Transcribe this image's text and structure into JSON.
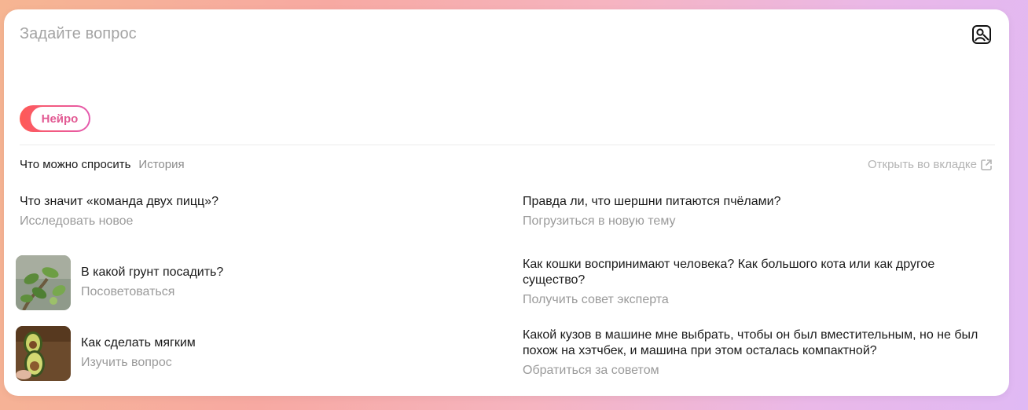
{
  "search": {
    "placeholder": "Задайте вопрос"
  },
  "toggle": {
    "label": "Нейро"
  },
  "tabs": [
    {
      "label": "Что можно спросить",
      "active": true
    },
    {
      "label": "История",
      "active": false
    }
  ],
  "open_in_tab": {
    "label": "Открыть во вкладке",
    "icon": "external-link-icon"
  },
  "suggestions_left": [
    {
      "question": "Что значит «команда двух пицц»?",
      "subtitle": "Исследовать новое",
      "thumbnail": null
    },
    {
      "question": "В какой грунт посадить?",
      "subtitle": "Посоветоваться",
      "thumbnail": "plant"
    },
    {
      "question": "Как сделать мягким",
      "subtitle": "Изучить вопрос",
      "thumbnail": "avocado"
    }
  ],
  "suggestions_right": [
    {
      "question": "Правда ли, что шершни питаются пчёлами?",
      "subtitle": "Погрузиться в новую тему"
    },
    {
      "question_line1": "Как кошки воспринимают человека? Как большого кота или как другое",
      "question_line2": "существо?",
      "subtitle": "Получить совет эксперта"
    },
    {
      "question_line1": "Какой кузов в машине мне выбрать, чтобы он был вместительным, но не был",
      "question_line2": "похож на хэтчбек, и машина при этом осталась компактной?",
      "subtitle": "Обратиться за советом"
    }
  ],
  "colors": {
    "accent_start": "#ff5a55",
    "accent_end": "#e45bb0",
    "toggle_text": "#e25a93"
  },
  "icons": {
    "image_search": "image-search-icon"
  }
}
